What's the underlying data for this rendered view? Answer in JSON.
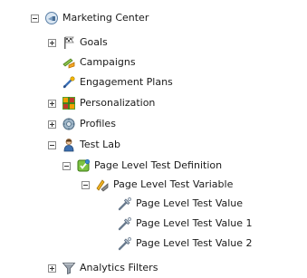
{
  "tree": {
    "marketing_center": "Marketing Center",
    "goals": "Goals",
    "campaigns": "Campaigns",
    "engagement_plans": "Engagement Plans",
    "personalization": "Personalization",
    "profiles": "Profiles",
    "test_lab": "Test Lab",
    "page_level_test_definition": "Page Level Test Definition",
    "page_level_test_variable": "Page Level Test Variable",
    "page_level_test_value": "Page Level Test Value",
    "page_level_test_value_1": "Page Level Test Value 1",
    "page_level_test_value_2": "Page Level Test Value 2",
    "analytics_filters": "Analytics Filters"
  },
  "icons": {
    "marketing_center": "marketing-center-icon",
    "goals": "goals-flag-icon",
    "campaigns": "campaigns-icon",
    "engagement_plans": "engagement-plans-icon",
    "personalization": "personalization-icon",
    "profiles": "profiles-icon",
    "test_lab": "test-lab-icon",
    "page_level_test_definition": "test-definition-icon",
    "page_level_test_variable": "test-variable-icon",
    "page_level_test_value": "test-value-icon",
    "analytics_filters": "analytics-filter-icon"
  }
}
